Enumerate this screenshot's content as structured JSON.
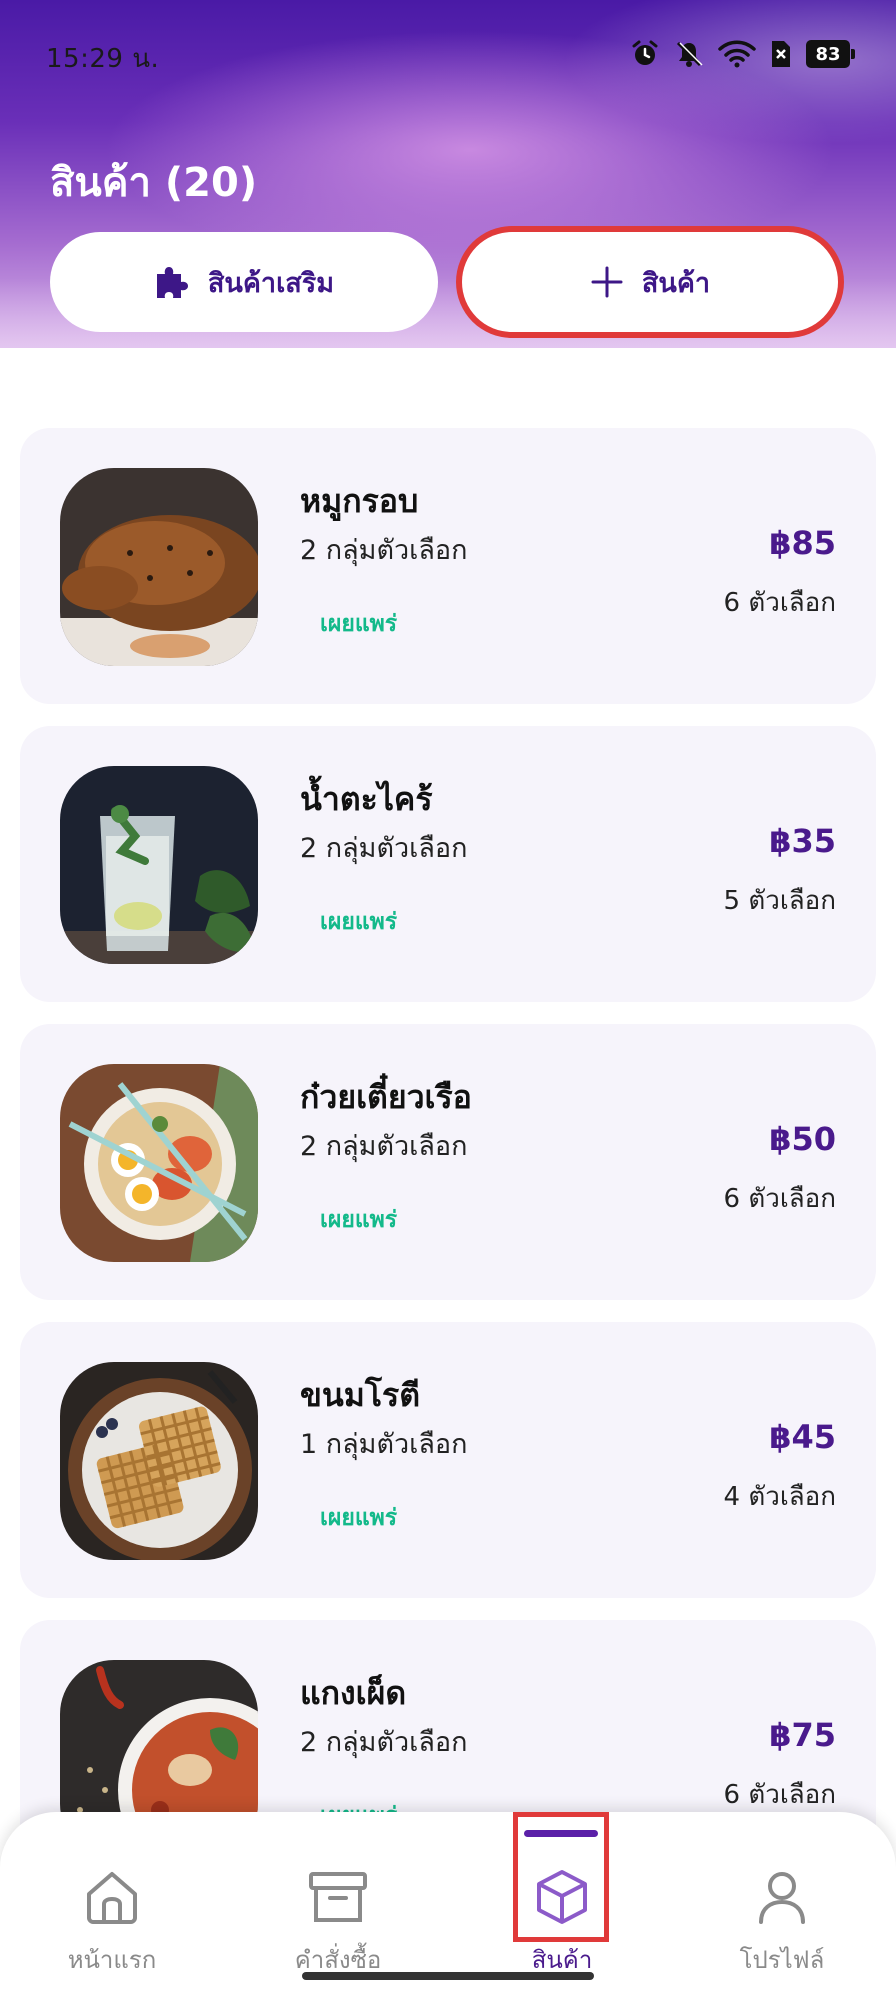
{
  "status_bar": {
    "time": "15:29 น.",
    "battery": "83",
    "icons": [
      "alarm-icon",
      "mute-icon",
      "wifi-icon",
      "sim-icon",
      "battery-icon"
    ]
  },
  "header": {
    "title": "สินค้า (20)",
    "addon_button_label": "สินค้าเสริม",
    "add_button_label": "สินค้า",
    "accent_color": "#4a1a8c"
  },
  "products": [
    {
      "name": "หมูกรอบ",
      "groups": "2 กลุ่มตัวเลือก",
      "status": "เผยแพร่",
      "price": "฿85",
      "options": "6 ตัวเลือก",
      "image": "roast-image"
    },
    {
      "name": "น้ำตะไคร้",
      "groups": "2 กลุ่มตัวเลือก",
      "status": "เผยแพร่",
      "price": "฿35",
      "options": "5 ตัวเลือก",
      "image": "drink-image"
    },
    {
      "name": "ก๋วยเตี๋ยวเรือ",
      "groups": "2 กลุ่มตัวเลือก",
      "status": "เผยแพร่",
      "price": "฿50",
      "options": "6 ตัวเลือก",
      "image": "noodle-image"
    },
    {
      "name": "ขนมโรตี",
      "groups": "1 กลุ่มตัวเลือก",
      "status": "เผยแพร่",
      "price": "฿45",
      "options": "4 ตัวเลือก",
      "image": "waffle-image"
    },
    {
      "name": "แกงเผ็ด",
      "groups": "2 กลุ่มตัวเลือก",
      "status": "เผยแพร่",
      "price": "฿75",
      "options": "6 ตัวเลือก",
      "image": "curry-image"
    }
  ],
  "bottom_nav": {
    "items": [
      {
        "label": "หน้าแรก",
        "icon": "home-icon"
      },
      {
        "label": "คำสั่งซื้อ",
        "icon": "archive-icon"
      },
      {
        "label": "สินค้า",
        "icon": "box-icon",
        "active": true
      },
      {
        "label": "โปรไฟล์",
        "icon": "user-icon"
      }
    ]
  },
  "colors": {
    "price": "#4a1a8c",
    "status_published": "#13b98a",
    "highlight": "#e03a3a"
  }
}
